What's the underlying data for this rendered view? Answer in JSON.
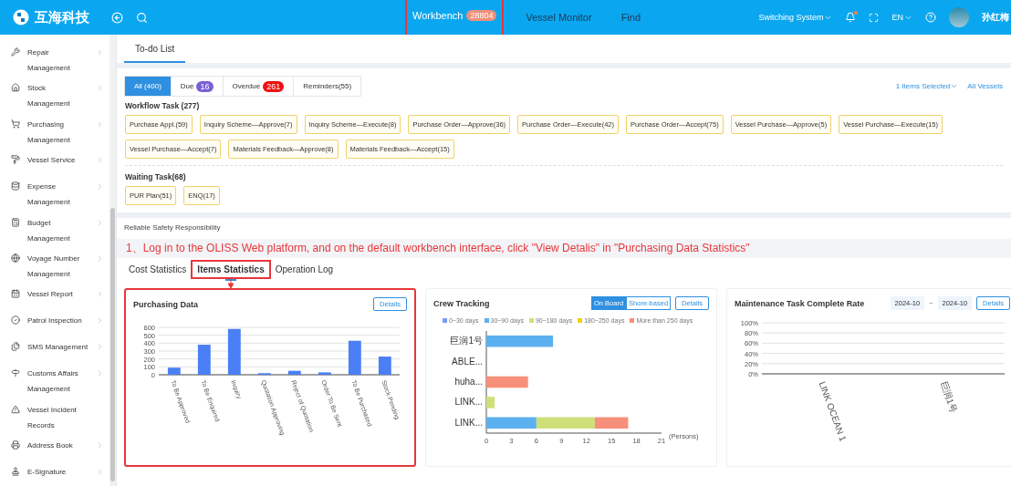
{
  "header": {
    "logo_text": "互海科技",
    "nav": [
      {
        "label": "Workbench",
        "badge": "28804",
        "selected": true,
        "highlighted": true
      },
      {
        "label": "Vessel Monitor",
        "selected": false,
        "highlighted": false
      },
      {
        "label": "Find",
        "selected": false,
        "highlighted": false
      }
    ],
    "system_switch": "Switching System",
    "notification_dot": true,
    "language": "EN",
    "user_name": "孙红梅"
  },
  "sidebar": {
    "items": [
      {
        "label": "Repair Management",
        "expandable": true
      },
      {
        "label": "Stock Management",
        "expandable": true
      },
      {
        "label": "Purchasing Management",
        "expandable": true
      },
      {
        "label": "Vessel Service",
        "expandable": true
      },
      {
        "label": "Expense Management",
        "expandable": true
      },
      {
        "label": "Budget Management",
        "expandable": true
      },
      {
        "label": "Voyage Number Management",
        "expandable": true
      },
      {
        "label": "Vessel Report",
        "expandable": true
      },
      {
        "label": "Patrol Inspection",
        "expandable": true
      },
      {
        "label": "SMS Management",
        "expandable": true
      },
      {
        "label": "Customs Affairs Management",
        "expandable": true
      },
      {
        "label": "Vessel Incident Records",
        "expandable": false
      },
      {
        "label": "Address Book",
        "expandable": true
      },
      {
        "label": "E-Signature",
        "expandable": true
      }
    ]
  },
  "page_tabs": [
    {
      "label": "To-do List",
      "selected": true
    }
  ],
  "todo": {
    "filters": [
      {
        "label": "All (400)",
        "selected": true
      },
      {
        "label": "Due",
        "badge": "16",
        "color": "#7a5fd3",
        "selected": false
      },
      {
        "label": "Overdue",
        "badge": "261",
        "color": "#ee1111",
        "selected": false
      },
      {
        "label": "Reminders(55)",
        "selected": false
      }
    ],
    "items_selected": "1 Items Selected",
    "vessels": "All Vessels",
    "groups": [
      {
        "title": "Workflow Task (277)",
        "chips": [
          "Purchase Appl.(59)",
          "Inquiry Scheme—Approve(7)",
          "Inquiry Scheme—Execute(8)",
          "Purchase Order—Approve(36)",
          "Purchase Order—Execute(42)",
          "Purchase Order—Accept(75)",
          "Vessel Purchase—Approve(5)",
          "Vessel Purchase—Execute(15)",
          "Vessel Purchase—Accept(7)",
          "Materials Feedback—Approve(8)",
          "Materials Feedback—Accept(15)"
        ]
      },
      {
        "title": "Waiting Task(68)",
        "chips": [
          "PUR Plan(51)",
          "ENQ(17)"
        ]
      }
    ]
  },
  "safety_banner": "Reliable Safety Responsibility",
  "instruction": "1、Log in to the OLISS Web platform, and on the default workbench interface, click \"View Detalis\" in \"Purchasing Data Statistics\"",
  "stat_tabs": [
    {
      "label": "Cost Statistics",
      "selected": false,
      "highlighted": false
    },
    {
      "label": "Items Statistics",
      "selected": true,
      "highlighted": true
    },
    {
      "label": "Operation Log",
      "selected": false,
      "highlighted": false
    }
  ],
  "cards": [
    {
      "title": "Purchasing Data",
      "highlighted": true,
      "details": "Details",
      "chart_data": {
        "type": "bar",
        "grid": true,
        "categories": [
          "To Be Approved",
          "To Be Enquired",
          "Inquiry",
          "Quotation Approving",
          "Reject of Quotation",
          "Order To Be Sent",
          "To Be Purchased",
          "Stock Pending"
        ],
        "series": [
          {
            "color": "#4a7ff5",
            "values": [
              90,
              380,
              580,
              20,
              50,
              30,
              430,
              230
            ]
          }
        ],
        "ylim": [
          0,
          600
        ],
        "yticks": [
          0,
          100,
          200,
          300,
          400,
          500,
          600
        ]
      }
    },
    {
      "title": "Crew Tracking",
      "highlighted": false,
      "details": "Details",
      "toggle": [
        {
          "label": "On Board",
          "selected": true
        },
        {
          "label": "Shore-based",
          "selected": false
        }
      ],
      "chart_data": {
        "type": "bar",
        "orientation": "horizontal",
        "stacked": true,
        "xlabel": "(Persons)",
        "categories": [
          "巨润1号",
          "ABLE...",
          "huha...",
          "LINK...",
          "LINK..."
        ],
        "series": [
          {
            "name": "0~30 days",
            "color": "#7c9cf2",
            "values": [
              0,
              0,
              0,
              0,
              0
            ]
          },
          {
            "name": "30~90 days",
            "color": "#5cb0f0",
            "values": [
              8,
              0,
              0,
              0,
              6
            ]
          },
          {
            "name": "90~180 days",
            "color": "#cfe07a",
            "values": [
              0,
              0,
              0,
              1,
              7
            ]
          },
          {
            "name": "180~250 days",
            "color": "#f5d000",
            "values": [
              0,
              0,
              0,
              0,
              0
            ]
          },
          {
            "name": "More than 250 days",
            "color": "#f7907a",
            "values": [
              0,
              0,
              5,
              0,
              4
            ]
          }
        ],
        "xlim": [
          0,
          21
        ],
        "xticks": [
          0,
          3,
          6,
          9,
          12,
          15,
          18,
          21
        ]
      }
    },
    {
      "title": "Maintenance Task Complete Rate",
      "highlighted": false,
      "details": "Details",
      "date_from": "2024-10",
      "date_sep": "~",
      "date_to": "2024-10",
      "chart_data": {
        "type": "line",
        "grid": true,
        "categories": [
          "LINK OCEAN 1",
          "巨润1号"
        ],
        "ylim": [
          0,
          100
        ],
        "yticks": [
          {
            "value": 0,
            "label": "0%"
          },
          {
            "value": 20,
            "label": "20%"
          },
          {
            "value": 40,
            "label": "40%"
          },
          {
            "value": 60,
            "label": "60%"
          },
          {
            "value": 80,
            "label": "80%"
          },
          {
            "value": 100,
            "label": "100%"
          }
        ]
      }
    }
  ]
}
